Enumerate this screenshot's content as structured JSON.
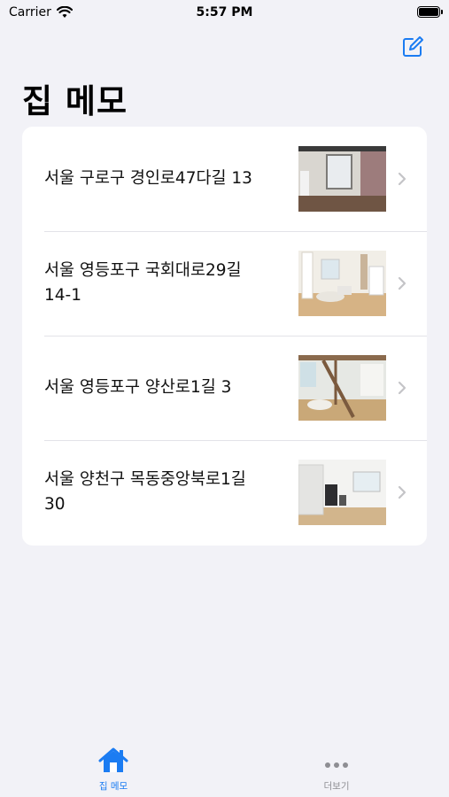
{
  "status": {
    "carrier": "Carrier",
    "time": "5:57 PM"
  },
  "header": {
    "title": "집 메모"
  },
  "list": {
    "items": [
      {
        "address": "서울 구로구 경인로47다길 13"
      },
      {
        "address": "서울 영등포구 국회대로29길 14-1"
      },
      {
        "address": "서울 영등포구 양산로1길 3"
      },
      {
        "address": "서울 양천구 목동중앙북로1길 30"
      }
    ]
  },
  "tabbar": {
    "tabs": [
      {
        "label": "집 메모",
        "icon": "house-icon",
        "selected": true
      },
      {
        "label": "더보기",
        "icon": "ellipsis-icon",
        "selected": false
      }
    ]
  },
  "colors": {
    "accent": "#1b7cf2",
    "background": "#f2f2f7",
    "inactive": "#8e8e93"
  }
}
